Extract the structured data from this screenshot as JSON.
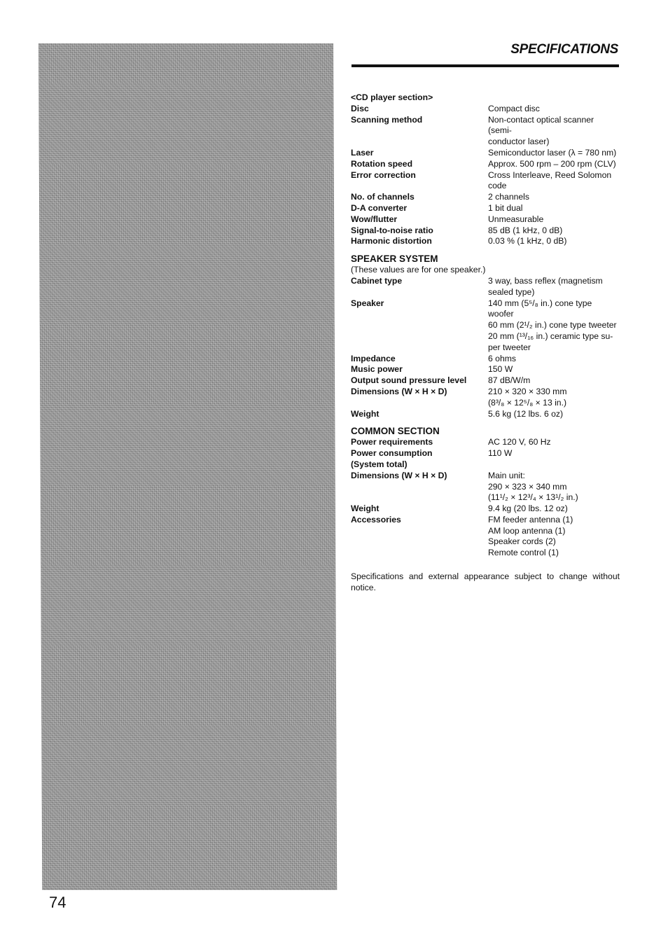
{
  "page": {
    "title": "SPECIFICATIONS",
    "page_number": "74"
  },
  "cd_section": {
    "heading": "<CD player section>",
    "rows": [
      {
        "label": "Disc",
        "value": [
          "Compact disc"
        ]
      },
      {
        "label": "Scanning method",
        "value": [
          "Non-contact optical scanner (semi-",
          "conductor laser)"
        ]
      },
      {
        "label": "Laser",
        "value": [
          "Semiconductor laser (λ = 780 nm)"
        ]
      },
      {
        "label": "Rotation speed",
        "value": [
          "Approx. 500 rpm – 200 rpm (CLV)"
        ]
      },
      {
        "label": "Error correction",
        "value": [
          "Cross Interleave, Reed Solomon",
          "code"
        ]
      },
      {
        "label": "No. of channels",
        "value": [
          "2 channels"
        ]
      },
      {
        "label": "D-A converter",
        "value": [
          "1 bit dual"
        ]
      },
      {
        "label": "Wow/flutter",
        "value": [
          "Unmeasurable"
        ]
      },
      {
        "label": "Signal-to-noise ratio",
        "value": [
          "85 dB (1 kHz, 0 dB)"
        ]
      },
      {
        "label": "Harmonic distortion",
        "value": [
          "0.03 % (1 kHz, 0 dB)"
        ]
      }
    ]
  },
  "speaker_section": {
    "heading": "SPEAKER SYSTEM",
    "note": "(These values are for one speaker.)",
    "rows": [
      {
        "label": "Cabinet type",
        "value": [
          "3 way, bass reflex (magnetism",
          "sealed type)"
        ]
      },
      {
        "label": "Speaker",
        "value": [
          "140 mm (5⁵/₈ in.) cone type woofer",
          "60 mm (2¹/₂ in.) cone type tweeter",
          "20 mm (¹³/₁₆ in.) ceramic type su-",
          "per tweeter"
        ]
      },
      {
        "label": "Impedance",
        "value": [
          "6 ohms"
        ]
      },
      {
        "label": "Music power",
        "value": [
          "150 W"
        ]
      },
      {
        "label": "Output sound pressure level",
        "value": [
          "87 dB/W/m"
        ]
      },
      {
        "label": "Dimensions (W × H × D)",
        "value": [
          "210 × 320 × 330 mm",
          "(8³/₈ × 12⁵/₈ × 13 in.)"
        ]
      },
      {
        "label": "Weight",
        "value": [
          "5.6 kg (12 lbs. 6 oz)"
        ]
      }
    ]
  },
  "common_section": {
    "heading": "COMMON SECTION",
    "rows": [
      {
        "label": "Power requirements",
        "value": [
          "AC 120 V, 60 Hz"
        ]
      },
      {
        "label": "Power consumption",
        "value": [
          "110 W"
        ]
      },
      {
        "label": "(System total)",
        "value": []
      },
      {
        "label": "Dimensions (W × H × D)",
        "value": [
          "Main unit:",
          "290 × 323 × 340 mm",
          "(11¹/₂ × 12³/₄ × 13¹/₂ in.)"
        ]
      },
      {
        "label": "Weight",
        "value": [
          "9.4 kg (20 lbs. 12 oz)"
        ]
      },
      {
        "label": "Accessories",
        "value": [
          "FM feeder antenna (1)",
          "AM loop antenna (1)",
          "Speaker cords (2)",
          "Remote control (1)"
        ]
      }
    ]
  },
  "footer_note": "Specifications and external appearance subject to change without notice."
}
